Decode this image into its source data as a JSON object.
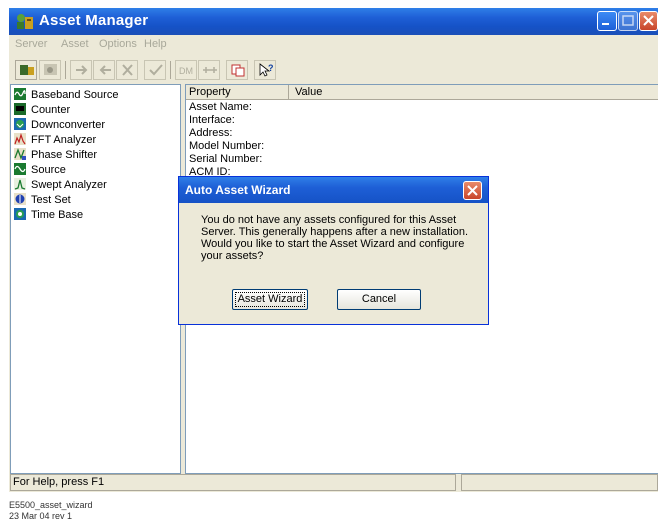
{
  "window": {
    "title": "Asset Manager"
  },
  "menu": [
    {
      "label": "Server"
    },
    {
      "label": "Asset"
    },
    {
      "label": "Options"
    },
    {
      "label": "Help"
    }
  ],
  "tree": {
    "items": [
      {
        "label": "Baseband Source",
        "icon": "waveform-icon"
      },
      {
        "label": "Counter",
        "icon": "counter-icon"
      },
      {
        "label": "Downconverter",
        "icon": "downconverter-icon"
      },
      {
        "label": "FFT Analyzer",
        "icon": "fft-analyzer-icon"
      },
      {
        "label": "Phase Shifter",
        "icon": "phase-shifter-icon"
      },
      {
        "label": "Source",
        "icon": "source-icon"
      },
      {
        "label": "Swept Analyzer",
        "icon": "swept-analyzer-icon"
      },
      {
        "label": "Test Set",
        "icon": "test-set-icon"
      },
      {
        "label": "Time Base",
        "icon": "time-base-icon"
      }
    ]
  },
  "properties": {
    "col_property": "Property",
    "col_value": "Value",
    "rows": [
      "Asset Name:",
      "Interface:",
      "Address:",
      "Model Number:",
      "Serial Number:",
      "ACM ID:"
    ]
  },
  "status": {
    "text": "For Help, press F1"
  },
  "dialog": {
    "title": "Auto Asset Wizard",
    "message": "You do not have any assets configured for this Asset Server. This generally happens after a new installation.  Would you like to start the Asset Wizard and configure your assets?",
    "ok_label": "Asset Wizard",
    "cancel_label": "Cancel"
  },
  "caption": {
    "line1": "E5500_asset_wizard",
    "line2": "23 Mar 04  rev 1"
  }
}
